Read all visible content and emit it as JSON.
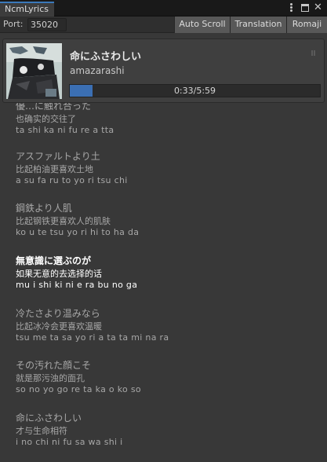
{
  "window": {
    "tab_label": "NcmLyrics",
    "icons": [
      "kebab-menu-icon",
      "maximize-icon",
      "close-icon"
    ]
  },
  "toolbar": {
    "port_label": "Port:",
    "port_value": "35020",
    "auto_scroll_label": "Auto Scroll",
    "translation_label": "Translation",
    "romaji_label": "Romaji"
  },
  "now_playing": {
    "title": "命にふさわしい",
    "artist": "amazarashi",
    "progress_text": "0:33/5:59",
    "progress_fraction": 0.092,
    "cover_icon": "album-cover"
  },
  "lyrics": [
    {
      "jp": "優…に触れ合った",
      "cn": "也确实的交往了",
      "romaji": "ta shi ka ni fu re a tta",
      "active": false
    },
    {
      "jp": "アスファルトより土",
      "cn": "比起柏油更喜欢土地",
      "romaji": "a su fa ru to yo ri tsu chi",
      "active": false
    },
    {
      "jp": "鋼鉄より人肌",
      "cn": "比起钢铁更喜欢人的肌肤",
      "romaji": "ko u te tsu yo ri hi to ha da",
      "active": false
    },
    {
      "jp": "無意識に選ぶのが",
      "cn": "如果无意的去选择的话",
      "romaji": "mu i shi ki ni e ra bu no ga",
      "active": true
    },
    {
      "jp": "冷たさより温みなら",
      "cn": "比起冰冷会更喜欢温暖",
      "romaji": "tsu me ta sa yo ri a ta ta mi na ra",
      "active": false
    },
    {
      "jp": "その汚れた顔こそ",
      "cn": "就是那污浊的面孔",
      "romaji": "so no yo go re ta ka o ko so",
      "active": false
    },
    {
      "jp": "命にふさわしい",
      "cn": "才与生命相符",
      "romaji": "i no chi ni fu sa wa shi i",
      "active": false
    }
  ],
  "colors": {
    "accent": "#3a79bb",
    "progress": "#3b6fb3",
    "background": "#383838",
    "highlight_text": "#ffffff"
  }
}
